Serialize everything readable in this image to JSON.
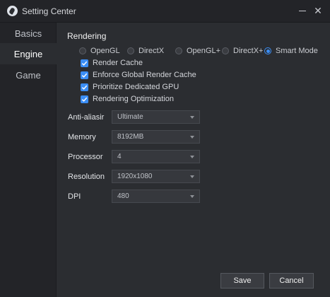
{
  "window": {
    "title": "Setting Center"
  },
  "sidebar": {
    "items": [
      {
        "label": "Basics"
      },
      {
        "label": "Engine"
      },
      {
        "label": "Game"
      }
    ]
  },
  "rendering": {
    "section_title": "Rendering",
    "options": [
      "OpenGL",
      "DirectX",
      "OpenGL+",
      "DirectX+",
      "Smart Mode"
    ],
    "selected": "Smart Mode",
    "checkboxes": [
      {
        "label": "Render Cache",
        "checked": true
      },
      {
        "label": "Enforce Global Render Cache",
        "checked": true
      },
      {
        "label": "Prioritize Dedicated GPU",
        "checked": true
      },
      {
        "label": "Rendering Optimization",
        "checked": true
      }
    ]
  },
  "fields": {
    "anti_aliasing": {
      "label": "Anti-aliasir",
      "value": "Ultimate"
    },
    "memory": {
      "label": "Memory",
      "value": "8192MB"
    },
    "processor": {
      "label": "Processor",
      "value": "4"
    },
    "resolution": {
      "label": "Resolution",
      "value": "1920x1080"
    },
    "dpi": {
      "label": "DPI",
      "value": "480"
    }
  },
  "buttons": {
    "save": "Save",
    "cancel": "Cancel"
  },
  "colors": {
    "accent": "#3b8ef5",
    "background": "#2b2d31",
    "sidebar": "#232428"
  }
}
